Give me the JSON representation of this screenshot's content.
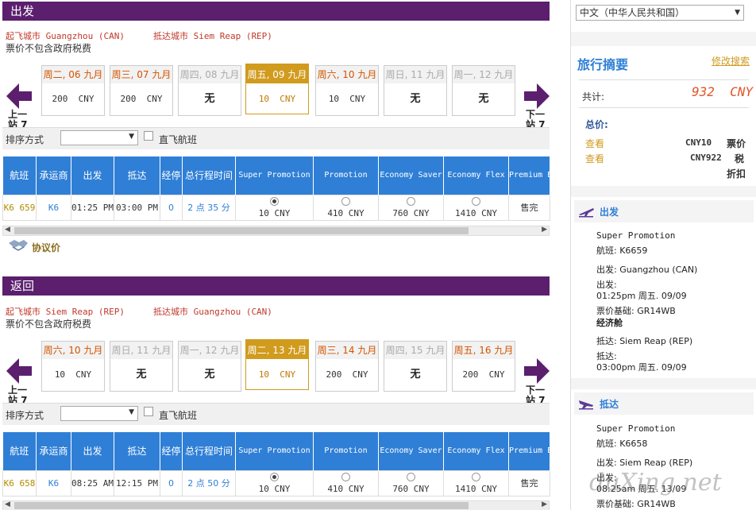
{
  "outbound": {
    "header": "出发",
    "origin": "起飞城市 Guangzhou (CAN)",
    "destination": "抵达城市 Siem Reap (REP)",
    "tax_note": "票价不包含政府税费",
    "prev_label_1": "上一",
    "prev_label_2": "站  7",
    "next_label_1": "下一",
    "next_label_2": "站  7",
    "dates": [
      {
        "day": "周二, 06 九月",
        "price": "200  CNY",
        "state": "avail"
      },
      {
        "day": "周三, 07 九月",
        "price": "200  CNY",
        "state": "avail"
      },
      {
        "day": "周四, 08 九月",
        "price": "无",
        "state": "na"
      },
      {
        "day": "周五, 09 九月",
        "price": "10  CNY",
        "state": "selected"
      },
      {
        "day": "周六, 10 九月",
        "price": "10  CNY",
        "state": "avail"
      },
      {
        "day": "周日, 11 九月",
        "price": "无",
        "state": "na"
      },
      {
        "day": "周一, 12 九月",
        "price": "无",
        "state": "na"
      }
    ],
    "sort_label": "排序方式",
    "nonstop_label": "直飞航班",
    "row": {
      "flight": "K6 659",
      "carrier": "K6",
      "depart": "01:25 PM",
      "arrive": "03:00 PM",
      "stops": "0",
      "duration": "2 点 35 分",
      "fares": [
        "10  CNY",
        "410  CNY",
        "760  CNY",
        "1410  CNY"
      ],
      "premium": "售完"
    },
    "protocol": "协议价"
  },
  "return": {
    "header": "返回",
    "origin": "起飞城市 Siem Reap (REP)",
    "destination": "抵达城市 Guangzhou (CAN)",
    "tax_note": "票价不包含政府税费",
    "prev_label_1": "上一",
    "prev_label_2": "站  7",
    "next_label_1": "下一",
    "next_label_2": "站  7",
    "dates": [
      {
        "day": "周六, 10 九月",
        "price": "10  CNY",
        "state": "avail"
      },
      {
        "day": "周日, 11 九月",
        "price": "无",
        "state": "na"
      },
      {
        "day": "周一, 12 九月",
        "price": "无",
        "state": "na"
      },
      {
        "day": "周二, 13 九月",
        "price": "10  CNY",
        "state": "selected"
      },
      {
        "day": "周三, 14 九月",
        "price": "200  CNY",
        "state": "avail"
      },
      {
        "day": "周四, 15 九月",
        "price": "无",
        "state": "na"
      },
      {
        "day": "周五, 16 九月",
        "price": "200  CNY",
        "state": "avail"
      }
    ],
    "sort_label": "排序方式",
    "nonstop_label": "直飞航班",
    "row": {
      "flight": "K6 658",
      "carrier": "K6",
      "depart": "08:25 AM",
      "arrive": "12:15 PM",
      "stops": "0",
      "duration": "2 点 50 分",
      "fares": [
        "10  CNY",
        "410  CNY",
        "760  CNY",
        "1410  CNY"
      ],
      "premium": "售完"
    }
  },
  "table_headers": {
    "flight": "航班",
    "carrier": "承运商",
    "depart": "出发",
    "arrive": "抵达",
    "stops": "经停",
    "duration": "总行程时间",
    "fare1": "Super Promotion",
    "fare2": "Promotion",
    "fare3": "Economy Saver",
    "fare4": "Economy Flex",
    "fare5": "Premium Eco"
  },
  "sidebar": {
    "language": "中文（中华人民共和国）",
    "summary_title": "旅行摘要",
    "modify_search": "修改搜索",
    "total_label": "共计:",
    "total_value": "932  CNY",
    "total_price_label": "总价:",
    "view1": "查看",
    "view1_value": "CNY10",
    "view1_tag": "票价",
    "view2": "查看",
    "view2_value": "CNY922",
    "view2_tag_1": "税",
    "view2_tag_2": "折扣",
    "depart_segment": {
      "title": "出发",
      "fare_name": "Super Promotion",
      "flight": "航班:  K6659",
      "from": "出发:  Guangzhou (CAN)",
      "dep_label": "出发:",
      "dep_time": "01:25pm 周五. 09/09",
      "fare_basis": "票价基础:  GR14WB",
      "cabin": "经济舱",
      "to": "抵达:  Siem Reap (REP)",
      "arr_label": "抵达:",
      "arr_time": "03:00pm 周五. 09/09"
    },
    "arrive_segment": {
      "title": "抵达",
      "fare_name": "Super Promotion",
      "flight": "航班:  K6658",
      "from": "出发:  Siem Reap (REP)",
      "dep_label": "出发:",
      "dep_time": "08:25am 周五. 13/09",
      "fare_basis": "票价基础:  GR14WB"
    }
  },
  "watermark": "duXing.net",
  "colors": {
    "header_bg": "#5b1f6e",
    "table_header": "#2f7fd6",
    "selected": "#d19b1e"
  }
}
